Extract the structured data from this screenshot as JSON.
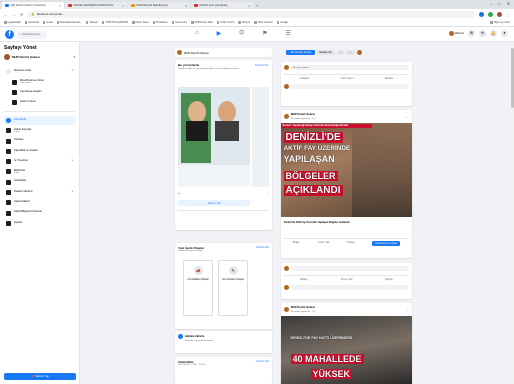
{
  "browser": {
    "tabs": [
      {
        "label": "(49) Denizli Şubesi | Facebook",
        "color": "#1877f2",
        "active": true
      },
      {
        "label": "DENIZLI DEĞİŞİMİ KOMPANYASI",
        "color": "#d93025",
        "active": false
      },
      {
        "label": "PAMUKKALE Belediyesi(1)",
        "color": "#f29900",
        "active": false
      },
      {
        "label": "PAMUK kent pamukkale",
        "color": "#d93025",
        "active": false
      }
    ],
    "new_tab": "+",
    "window_controls": [
      "–",
      "□",
      "✕"
    ],
    "url": "facebook.com/pmuk...",
    "bookmarks": [
      "Uygulamalar",
      "Facebook",
      "Gmail",
      "Bluestacks Emulat...",
      "Vikipedi",
      "TÜRKİYE GAZETESİ",
      "Haber Sitesi",
      "Photoshop",
      "Canva.com",
      "MHP Resmi Web",
      "Kültür Turizm",
      "Hürriyet",
      "Okul Yönetimi",
      "Google",
      "Diğer yer imleri"
    ]
  },
  "fb": {
    "logo": "f",
    "search_placeholder": "Facebook'ta ara",
    "nav_icons": [
      "⌂",
      "▶",
      "⛭",
      "⚑",
      "☰"
    ],
    "right_user": "Mehmet",
    "right_buttons": [
      "⊞",
      "✉",
      "🔔",
      "▾"
    ]
  },
  "sidebar": {
    "title": "Sayfayı Yönet",
    "page_name": "MHP Denizli Şubesi",
    "items": [
      {
        "label": "Business Suite",
        "sub": "",
        "chev": "▾",
        "active": false
      },
      {
        "label": "Meta Business Suite",
        "sub": "Tüm araçlar",
        "chev": "",
        "active": false,
        "indent": true
      },
      {
        "label": "Yayınlama Araçları",
        "sub": "",
        "chev": "",
        "active": false,
        "indent": true
      },
      {
        "label": "Gelen Kutusu",
        "sub": "",
        "chev": "",
        "active": false,
        "indent": true
      },
      {
        "label": "Ana Sayfa",
        "sub": "",
        "chev": "",
        "active": true
      },
      {
        "label": "Haber Kaynağı",
        "sub": "1 yeni",
        "chev": "",
        "active": false
      },
      {
        "label": "Podcast",
        "sub": "",
        "chev": "",
        "active": false
      },
      {
        "label": "Kaynaklar ve Araçlar",
        "sub": "",
        "chev": "",
        "active": false
      },
      {
        "label": "İş Yöneticisi",
        "sub": "",
        "chev": "▾",
        "active": false
      },
      {
        "label": "Bildirimler",
        "sub": "4 yeni",
        "chev": "",
        "active": false
      },
      {
        "label": "İstatistikler",
        "sub": "",
        "chev": "",
        "active": false
      },
      {
        "label": "Reklam Merkezi",
        "sub": "",
        "chev": "▾",
        "active": false
      },
      {
        "label": "Sayfa Kalitesi",
        "sub": "",
        "chev": "",
        "active": false
      },
      {
        "label": "Sayfa Bilgilerini Düzenle",
        "sub": "",
        "chev": "",
        "active": false
      },
      {
        "label": "Ayarlar",
        "sub": "",
        "chev": "",
        "active": false
      }
    ],
    "promote_label": "Tanıtım Yap"
  },
  "middle": {
    "page_header_name": "MHP Denizli Şubesi",
    "setup_card": {
      "title": "Bu yorumlarda",
      "subtitle": "Sayfanızı etkili bir deneyimle başlatın ve yeni takipçiler kazanın.",
      "link": "Tümünü Gör",
      "promo_button": "Tanıtımı Yap"
    },
    "actions_card": {
      "title": "Yeni İçerik Oluştur",
      "subtitle": "Sayfanız için yeni öneriler",
      "link": "Tümünü Gör",
      "tile1": "Yeni Reklam Oluştur",
      "tile2": "Yeni Gönderi Oluştur"
    },
    "insights_label": "Haftalık Aktivite",
    "insights_sub": "Bu hafta sayfanızdaki aktivite",
    "stats_title": "İstatistikler",
    "stats_link": "Tümünü Gör",
    "stats_sub": "Son 28 gün: 27 Eki – 23 Kas"
  },
  "feed": {
    "top_create_btn": "+ Bir Gönderi Oluştur",
    "top_ad_btn": "Reklam Ver",
    "composer_placeholder": "Bir şeyler yazın...",
    "composer_actions": [
      "Fotoğraf",
      "Canlı Yayın",
      "Etiketle"
    ],
    "post1": {
      "author": "MHP Denizli Şubesi",
      "meta": "Şu saatte paylaşıldı · 1 g",
      "banner": "Denizli, Yapılacağı Bölge Üzerinde Bulunduğu Binalar",
      "headline1": "DENİZLİ'DE",
      "headline2": "AKTİF FAY ÜZERİNDE",
      "headline3": "YAPILAŞAN",
      "headline4": "BÖLGELER",
      "headline5": "AÇIKLANDI",
      "caption": "Denizli'de Aktif Fay Üzerinde Yapılaşan Bölgeler Açıklandı",
      "actions": [
        "Beğen",
        "Yorum Yap",
        "Paylaş"
      ],
      "cta": "Gönderiyi Öne Çıkar"
    },
    "post2": {
      "author": "MHP Denizli Şubesi",
      "meta": "Şu saatte paylaşıldı · 2 g",
      "banner": "DENİZLİ'DE FAY HATTI ÜZERİNDEKİ",
      "headline1": "40 MAHALLEDE",
      "headline2": "YÜKSEK"
    }
  },
  "colors": {
    "fb_blue": "#1877f2",
    "feed_bg": "#f0f2f5",
    "banner_red": "#c8102e"
  }
}
